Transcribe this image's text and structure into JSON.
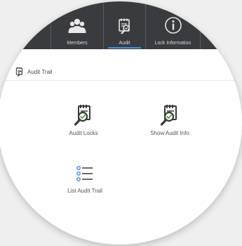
{
  "toolbar": {
    "tabs": [
      {
        "label": "Members",
        "icon": "members-icon",
        "active": false
      },
      {
        "label": "Audit",
        "icon": "audit-icon",
        "active": true
      },
      {
        "label": "Lock Information",
        "icon": "info-icon",
        "active": false
      }
    ]
  },
  "section": {
    "title": "Audit Trail",
    "icon": "audit-trail-icon"
  },
  "actions": [
    {
      "label": "Audit Locks",
      "icon": "audit-locks-icon"
    },
    {
      "label": "Show Audit Info",
      "icon": "show-audit-info-icon"
    },
    {
      "label": "List Audit Trail",
      "icon": "list-icon"
    }
  ],
  "colors": {
    "toolbar_bg": "#3a3b3e",
    "accent": "#3d8ee8",
    "icon_dark": "#3a3a3a",
    "check_green": "#5aa33a"
  }
}
